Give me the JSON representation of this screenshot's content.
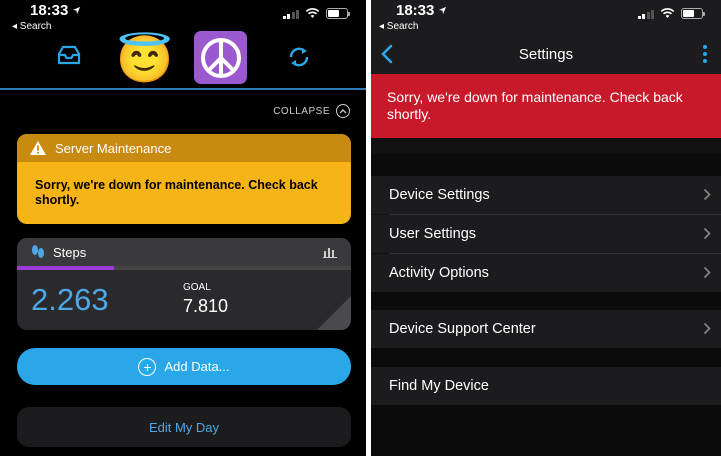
{
  "left": {
    "status": {
      "time": "18:33",
      "back": "◂ Search"
    },
    "topnav": {
      "emoji1": "😇",
      "emoji2": "☮"
    },
    "collapse": "COLLAPSE",
    "maintenance": {
      "title": "Server Maintenance",
      "message": "Sorry, we're down for maintenance. Check back shortly."
    },
    "steps": {
      "title": "Steps",
      "value": "2.263",
      "goal_label": "GOAL",
      "goal": "7.810",
      "progress_fraction": 0.29
    },
    "add_data": "Add Data...",
    "edit_day": "Edit My Day"
  },
  "right": {
    "status": {
      "time": "18:33",
      "back": "◂ Search"
    },
    "title": "Settings",
    "banner": "Sorry, we're down for maintenance. Check back shortly.",
    "items": [
      {
        "label": "Device Settings"
      },
      {
        "label": "User Settings"
      },
      {
        "label": "Activity Options"
      },
      {
        "label": "Device Support Center"
      },
      {
        "label": "Find My Device"
      }
    ]
  },
  "colors": {
    "accent_blue": "#2aa7e8",
    "maintenance_yellow": "#f7b417",
    "error_red": "#c8192b",
    "steps_purple": "#9b3dd6"
  }
}
